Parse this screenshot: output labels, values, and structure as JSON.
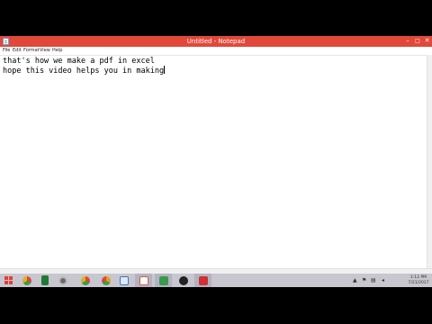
{
  "window": {
    "title": "Untitled - Notepad",
    "minimize_glyph": "–",
    "maximize_glyph": "□",
    "close_glyph": "✕"
  },
  "menu": {
    "file": "File",
    "edit": "Edit",
    "format": "Format",
    "view": "View",
    "help": "Help"
  },
  "editor": {
    "lines": [
      "that's how we make a pdf in excel",
      "hope this video helps you in making"
    ]
  },
  "taskbar": {
    "apps": [
      {
        "icon": "windows-start-icon",
        "color": "#e04030"
      },
      {
        "icon": "chrome-icon",
        "color": "#d84a3a"
      },
      {
        "icon": "excel-icon",
        "color": "#1f7a3a"
      },
      {
        "icon": "media-player-icon",
        "color": "#6a6a6a"
      },
      {
        "icon": "chrome-icon",
        "color": "#d84a3a"
      },
      {
        "icon": "chrome-icon",
        "color": "#e0a020"
      },
      {
        "icon": "window-app-icon",
        "color": "#3a78c8"
      },
      {
        "icon": "document-icon",
        "color": "#e05a3a"
      },
      {
        "icon": "spreadsheet-icon",
        "color": "#3a9a4a"
      },
      {
        "icon": "camera-app-icon",
        "color": "#222222"
      },
      {
        "icon": "pdf-icon",
        "color": "#d03030"
      }
    ],
    "tray_glyphs": [
      "▲",
      "⚑",
      "▤",
      "◂"
    ],
    "clock_time": "1:12 PM",
    "clock_date": "7/21/2017"
  },
  "colors": {
    "titlebar": "#e2483a",
    "taskbar": "#c8c6cf"
  }
}
